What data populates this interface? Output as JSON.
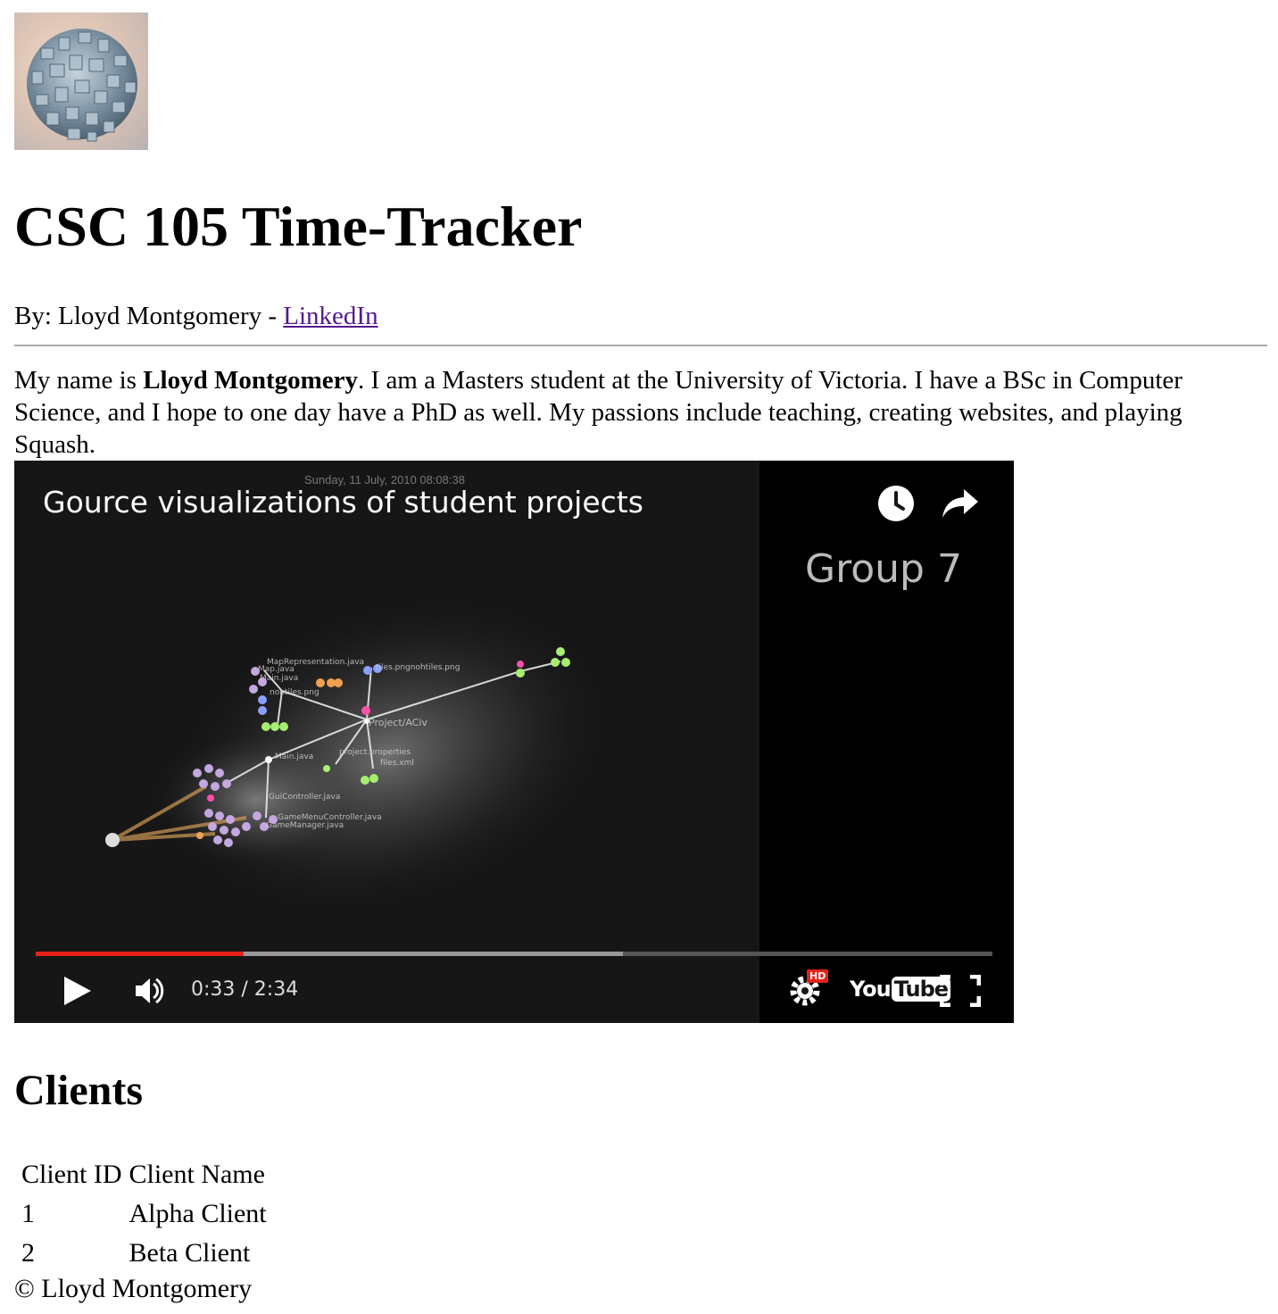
{
  "header": {
    "title": "CSC 105 Time-Tracker",
    "byline_prefix": "By: Lloyd Montgomery - ",
    "linkedin_label": "LinkedIn"
  },
  "bio": {
    "intro": "My name is ",
    "name": "Lloyd Montgomery",
    "rest": ". I am a Masters student at the University of Victoria. I have a BSc in Computer Science, and I hope to one day have a PhD as well. My passions include teaching, creating websites, and playing Squash."
  },
  "video": {
    "title": "Gource visualizations of student projects",
    "date": "Sunday, 11 July, 2010 08:08:38",
    "side_label": "Group 7",
    "time_display": "0:33 / 2:34",
    "played_fraction": 0.217,
    "buffered_fraction": 0.614,
    "icons": {
      "watch_later": "clock-icon",
      "share": "share-icon",
      "play": "play-icon",
      "volume": "volume-icon",
      "settings": "gear-icon",
      "hd_badge": "HD",
      "youtube_logo": "YouTube",
      "fullscreen": "fullscreen-icon"
    },
    "accent_color": "#e62117",
    "node_labels": [
      "MapRepresentation.java",
      "Map.java",
      "Main.java",
      "tiles.pngnohtiles.png",
      "nohtiles.png",
      "Project/ACiv",
      "Main.java",
      "project.properties",
      "files.xml",
      "GuiController.java",
      "GameMenuController.java",
      "GameManager.java"
    ]
  },
  "clients": {
    "heading": "Clients",
    "columns": [
      "Client ID",
      "Client Name"
    ],
    "rows": [
      {
        "id": "1",
        "name": "Alpha Client"
      },
      {
        "id": "2",
        "name": "Beta Client"
      }
    ]
  },
  "footer": {
    "copyright": "© Lloyd Montgomery"
  }
}
